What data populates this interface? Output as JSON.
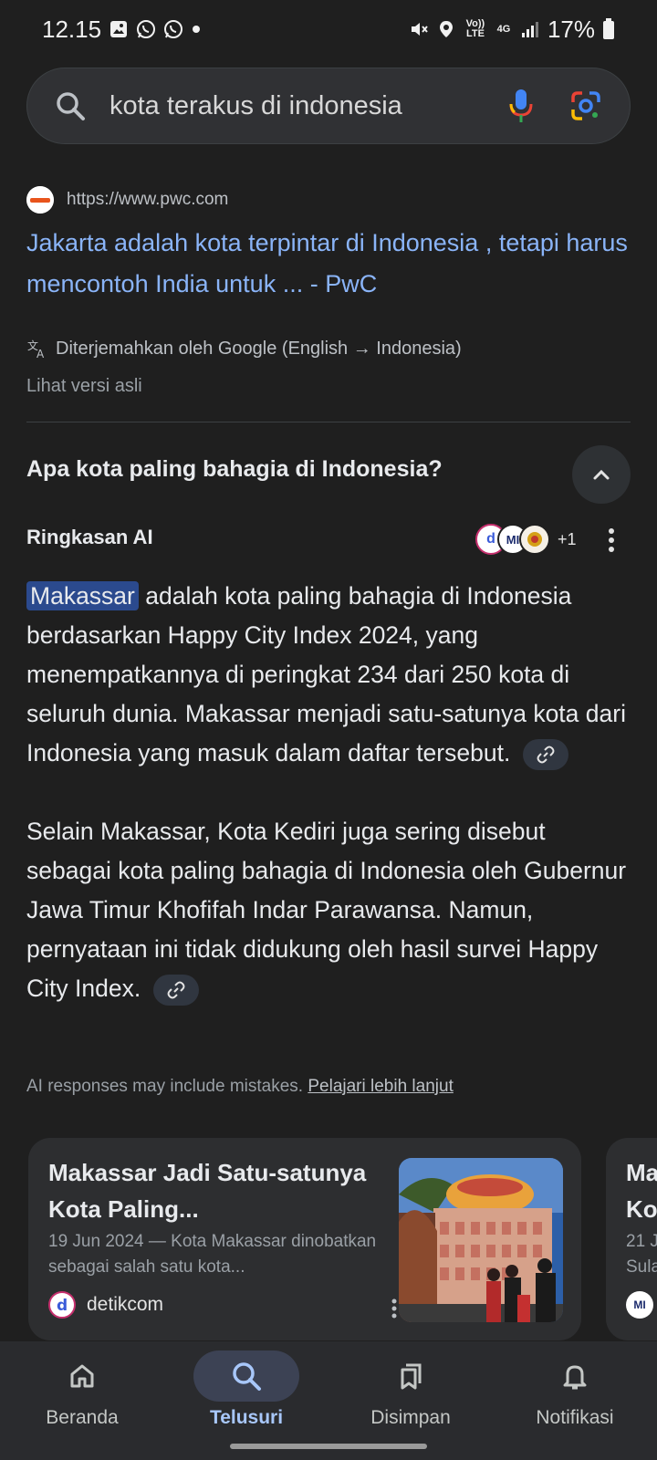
{
  "status_bar": {
    "time": "12.15",
    "volte": "Vo)) LTE",
    "network": "4G",
    "battery": "17%"
  },
  "search": {
    "query": "kota terakus di indonesia"
  },
  "result": {
    "url": "https://www.pwc.com",
    "title": "Jakarta adalah kota terpintar di Indonesia , tetapi harus mencontoh India untuk ... - PwC",
    "translated_note": "Diterjemahkan oleh Google (English → Indonesia)",
    "view_original": "Lihat versi asli"
  },
  "accordion": {
    "question": "Apa kota paling bahagia di Indonesia?"
  },
  "ai_overview": {
    "header": "Ringkasan AI",
    "source_more": "+1",
    "source_icons": [
      "d",
      "MI",
      ""
    ],
    "p1_highlight": "Makassar",
    "p1_rest": " adalah kota paling bahagia di Indonesia berdasarkan Happy City Index 2024, yang menempatkannya di peringkat 234 dari 250 kota di seluruh dunia. Makassar menjadi satu-satunya kota dari Indonesia yang masuk dalam daftar tersebut.",
    "p2": "Selain Makassar, Kota Kediri juga sering disebut sebagai kota paling bahagia di Indonesia oleh Gubernur Jawa Timur Khofifah Indar Parawansa. Namun, pernyataan ini tidak didukung oleh hasil survei Happy City Index.",
    "disclaimer": "AI responses may include mistakes. ",
    "learn_more": "Pelajari lebih lanjut"
  },
  "cards": [
    {
      "title": "Makassar Jadi Satu-satunya Kota Paling...",
      "date_snippet": "19 Jun 2024 — Kota Makassar dinobatkan sebagai salah satu kota...",
      "source": "detikcom",
      "source_icon": "d"
    },
    {
      "title_partial": "Ma",
      "title_partial2": "Ko",
      "meta_partial": "21 J",
      "meta_partial2": "Sula",
      "source_icon": "MI"
    }
  ],
  "bottom_nav": {
    "items": [
      {
        "label": "Beranda",
        "icon": "home-icon"
      },
      {
        "label": "Telusuri",
        "icon": "search-icon"
      },
      {
        "label": "Disimpan",
        "icon": "bookmarks-icon"
      },
      {
        "label": "Notifikasi",
        "icon": "bell-icon"
      }
    ],
    "active": "Telusuri"
  },
  "colors": {
    "background": "#1f1f1f",
    "link": "#8ab4f8",
    "highlight": "#2b4a8e",
    "active_nav": "#a8c7fa"
  }
}
